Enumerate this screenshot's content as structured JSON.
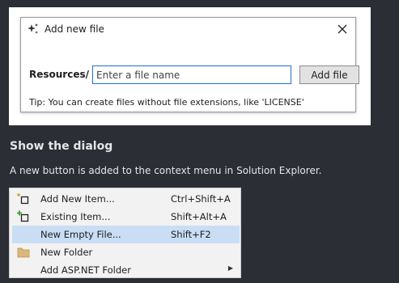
{
  "dialog": {
    "title": "Add new file",
    "resources_label": "Resources/",
    "input_placeholder": "Enter a file name",
    "input_value": "",
    "add_button": "Add file",
    "tip": "Tip: You can create files without file extensions, like 'LICENSE'"
  },
  "section": {
    "heading": "Show the dialog",
    "paragraph": "A new button is added to the context menu in Solution Explorer."
  },
  "menu": {
    "items": [
      {
        "label": "Add New Item...",
        "shortcut": "Ctrl+Shift+A",
        "icon": "add-new-item-icon"
      },
      {
        "label": "Existing Item...",
        "shortcut": "Shift+Alt+A",
        "icon": "existing-item-icon"
      },
      {
        "label": "New Empty File...",
        "shortcut": "Shift+F2",
        "icon": "none",
        "highlighted": true
      },
      {
        "label": "New Folder",
        "shortcut": "",
        "icon": "folder-icon"
      },
      {
        "label": "Add ASP.NET Folder",
        "shortcut": "",
        "icon": "none",
        "submenu": true
      }
    ]
  },
  "colors": {
    "background": "#2b2e35",
    "highlight": "#c9def5",
    "input_border": "#1f6fd1",
    "accent_green": "#3a9a3a",
    "folder_yellow": "#dcb67a"
  }
}
